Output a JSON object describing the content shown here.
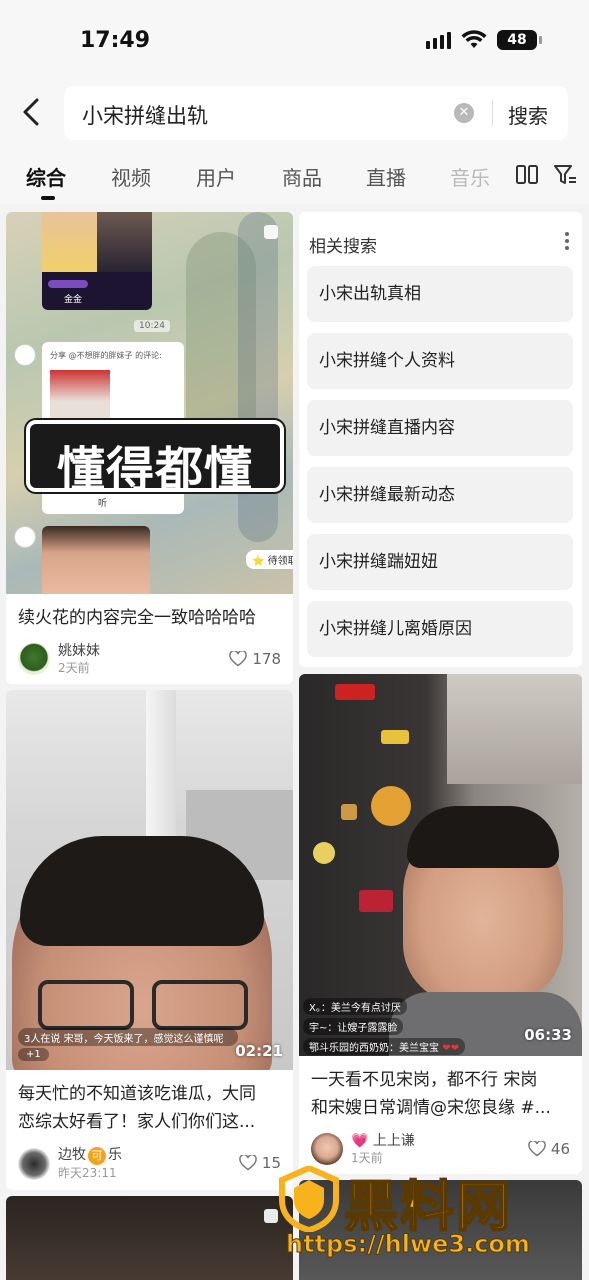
{
  "status_bar": {
    "time": "17:49",
    "battery": "48"
  },
  "search": {
    "query": "小宋拼缝出轨",
    "submit_label": "搜索"
  },
  "tabs": [
    {
      "label": "综合"
    },
    {
      "label": "视频"
    },
    {
      "label": "用户"
    },
    {
      "label": "商品"
    },
    {
      "label": "直播"
    },
    {
      "label": "音乐"
    }
  ],
  "cards": [
    {
      "overlay_text": "懂得都懂",
      "title": "续火花的内容完全一致哈哈哈哈",
      "author": "姚妹妹",
      "date": "2天前",
      "likes": "178",
      "badge": "待领取",
      "chat_time": "10:24",
      "chat_share": "分享 @不想胖的胖妹子 的评论:",
      "chat_name": "金金",
      "chat_listen": "听"
    },
    {
      "title_line1": "每天忙的不知道该吃谁瓜，大同",
      "title_line2": "恋综太好看了！家人们你们这...",
      "author": "边牧",
      "author_badge": "可",
      "author_suffix": "乐",
      "date": "昨天23:11",
      "likes": "15",
      "duration": "02:21",
      "comment_meta": "3人在说",
      "comment": "宋哥，今天饭来了，感觉这么谨慎呢",
      "plus": "+1"
    },
    {
      "title_line1": "一天看不见宋岗，都不行 宋岗",
      "title_line2": "和宋嫂日常调情@宋您良缘 #...",
      "author_emoji": "💗",
      "author": "上上谦",
      "date": "1天前",
      "likes": "46",
      "duration": "06:33",
      "comments": [
        {
          "user": "X。",
          "text": "美兰今有点讨厌"
        },
        {
          "user": "宇~",
          "text": "让嫂子露露脸"
        },
        {
          "user": "鄂斗乐园的西奶奶",
          "text": "美兰宝宝"
        }
      ]
    }
  ],
  "related": {
    "title": "相关搜索",
    "items": [
      "小宋出轨真相",
      "小宋拼缝个人资料",
      "小宋拼缝直播内容",
      "小宋拼缝最新动态",
      "小宋拼缝踹妞妞",
      "小宋拼缝儿离婚原因"
    ]
  },
  "watermark": {
    "brand": "黑料网",
    "url": "https://hlwe3.com"
  }
}
